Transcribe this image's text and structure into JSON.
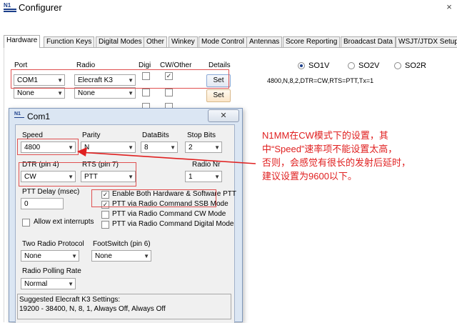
{
  "window": {
    "title": "Configurer",
    "close_glyph": "×"
  },
  "tabs": [
    "Hardware",
    "Function Keys",
    "Digital Modes",
    "Other",
    "Winkey",
    "Mode Control",
    "Antennas",
    "Score Reporting",
    "Broadcast Data",
    "WSJT/JTDX Setup"
  ],
  "active_tab": "Hardware",
  "hardware": {
    "headers": {
      "port": "Port",
      "radio": "Radio",
      "digi": "Digi",
      "cw_other": "CW/Other",
      "details": "Details"
    },
    "rows": [
      {
        "port": "COM1",
        "radio": "Elecraft K3",
        "digi": false,
        "cw_other": true,
        "details": "Set"
      },
      {
        "port": "None",
        "radio": "None",
        "digi": false,
        "cw_other": false,
        "details": "Set"
      }
    ],
    "so_options": [
      "SO1V",
      "SO2V",
      "SO2R"
    ],
    "so_selected": "SO1V",
    "port_summary": "4800,N,8,2,DTR=CW,RTS=PTT,Tx=1"
  },
  "dialog": {
    "title": "Com1",
    "close_glyph": "✕",
    "speed": {
      "label": "Speed",
      "value": "4800"
    },
    "parity": {
      "label": "Parity",
      "value": "N"
    },
    "databits": {
      "label": "DataBits",
      "value": "8"
    },
    "stopbits": {
      "label": "Stop Bits",
      "value": "2"
    },
    "dtr": {
      "label": "DTR (pin 4)",
      "value": "CW"
    },
    "rts": {
      "label": "RTS (pin 7)",
      "value": "PTT"
    },
    "radio_nr": {
      "label": "Radio Nr",
      "value": "1"
    },
    "ptt_delay": {
      "label": "PTT Delay  (msec)",
      "value": "0"
    },
    "options": [
      {
        "label": "Enable Both Hardware & Software PTT",
        "checked": true
      },
      {
        "label": "PTT via Radio Command SSB Mode",
        "checked": true
      },
      {
        "label": "PTT via Radio Command CW Mode",
        "checked": false
      },
      {
        "label": "PTT via Radio Command Digital Mode",
        "checked": false
      }
    ],
    "allow_ext_interrupts": {
      "label": "Allow ext interrupts",
      "checked": false
    },
    "two_radio_protocol": {
      "label": "Two Radio Protocol",
      "value": "None"
    },
    "footswitch": {
      "label": "FootSwitch (pin 6)",
      "value": "None"
    },
    "polling_rate": {
      "label": "Radio Polling Rate",
      "value": "Normal"
    },
    "suggested": {
      "title": "Suggested Elecraft K3 Settings:",
      "text": "19200 - 38400, N, 8, 1, Always Off, Always Off"
    }
  },
  "annotation": {
    "lines": [
      "N1MM在CW模式下的设置，其",
      "中“Speed”速率项不能设置太高，",
      "否则，会感觉有很长的发射后延时，",
      "建议设置为9600以下。"
    ],
    "color": "#e02020"
  }
}
